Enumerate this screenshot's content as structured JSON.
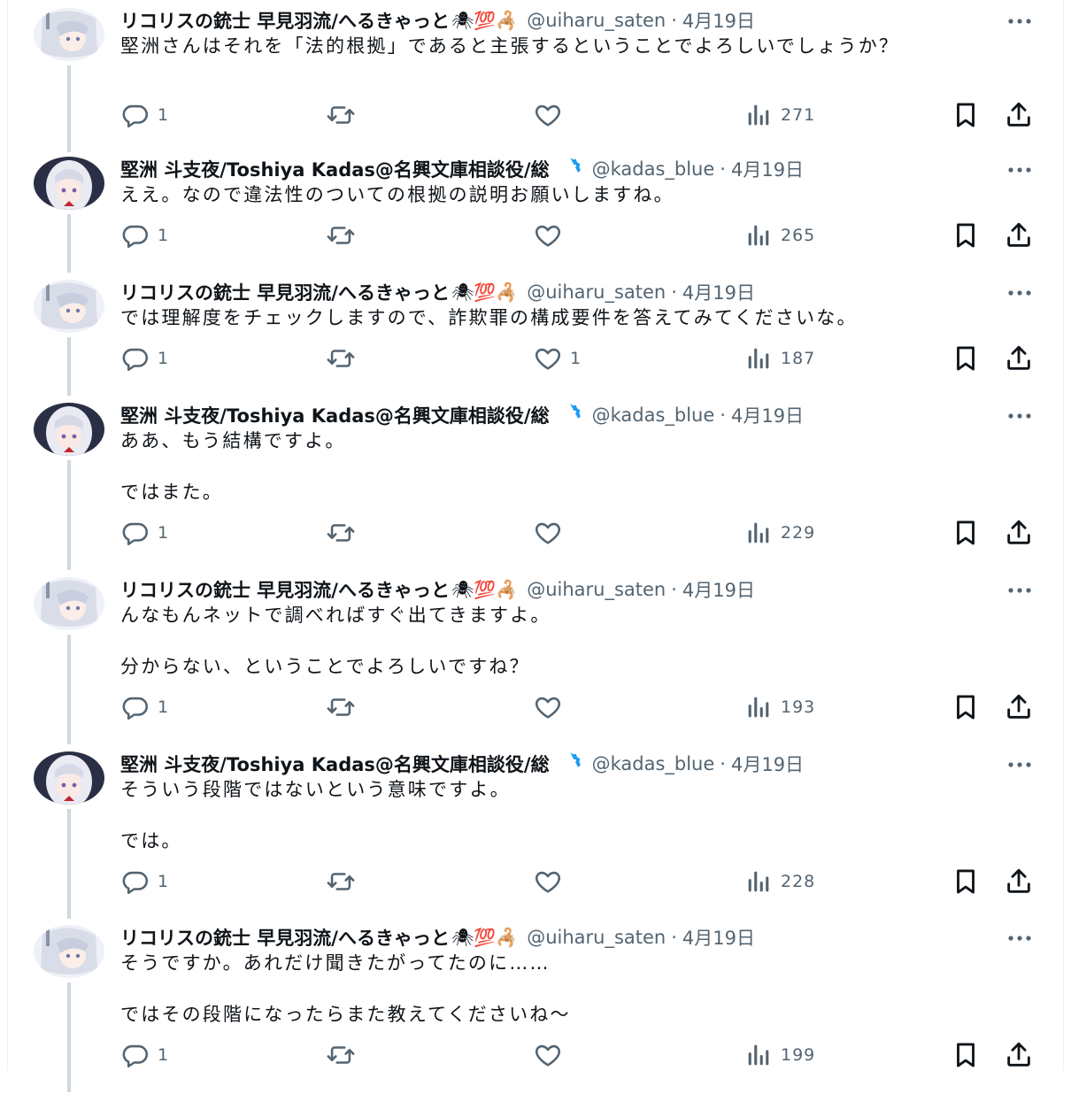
{
  "users": {
    "uiharu": {
      "name": "リコリスの銃士 早見羽流/へるきゃっと",
      "name_emoji": "🕷💯🦂",
      "handle": "@uiharu_saten",
      "verified": false
    },
    "kadas": {
      "name": "堅洲 斗支夜/Toshiya Kadas@名興文庫相談役/総",
      "name_emoji": "",
      "handle": "@kadas_blue",
      "verified": true
    }
  },
  "separator": "·",
  "tweets": [
    {
      "user": "uiharu",
      "name": "リコリスの銃士 早見羽流/へるきゃっと",
      "name_emoji": "🕷💯🦂",
      "handle": "@uiharu_saten",
      "date": "4月19日",
      "paragraphs": [
        "堅洲さんはそれを「法的根拠」であると主張するということでよろしいでしょうか？"
      ],
      "replies": "1",
      "retweets": "",
      "likes": "",
      "views": "271"
    },
    {
      "user": "kadas",
      "name": "堅洲 斗支夜/Toshiya Kadas@名興文庫相談役/総",
      "name_emoji": "",
      "handle": "@kadas_blue",
      "date": "4月19日",
      "paragraphs": [
        "ええ。なので違法性のついての根拠の説明お願いしますね。"
      ],
      "replies": "1",
      "retweets": "",
      "likes": "",
      "views": "265"
    },
    {
      "user": "uiharu",
      "name": "リコリスの銃士 早見羽流/へるきゃっと",
      "name_emoji": "🕷💯🦂",
      "handle": "@uiharu_saten",
      "date": "4月19日",
      "paragraphs": [
        "では理解度をチェックしますので、詐欺罪の構成要件を答えてみてくださいな。"
      ],
      "replies": "1",
      "retweets": "",
      "likes": "1",
      "views": "187"
    },
    {
      "user": "kadas",
      "name": "堅洲 斗支夜/Toshiya Kadas@名興文庫相談役/総",
      "name_emoji": "",
      "handle": "@kadas_blue",
      "date": "4月19日",
      "paragraphs": [
        "ああ、もう結構ですよ。",
        "ではまた。"
      ],
      "replies": "1",
      "retweets": "",
      "likes": "",
      "views": "229"
    },
    {
      "user": "uiharu",
      "name": "リコリスの銃士 早見羽流/へるきゃっと",
      "name_emoji": "🕷💯🦂",
      "handle": "@uiharu_saten",
      "date": "4月19日",
      "paragraphs": [
        "んなもんネットで調べればすぐ出てきますよ。",
        "分からない、ということでよろしいですね？"
      ],
      "replies": "1",
      "retweets": "",
      "likes": "",
      "views": "193"
    },
    {
      "user": "kadas",
      "name": "堅洲 斗支夜/Toshiya Kadas@名興文庫相談役/総",
      "name_emoji": "",
      "handle": "@kadas_blue",
      "date": "4月19日",
      "paragraphs": [
        "そういう段階ではないという意味ですよ。",
        "では。"
      ],
      "replies": "1",
      "retweets": "",
      "likes": "",
      "views": "228"
    },
    {
      "user": "uiharu",
      "name": "リコリスの銃士 早見羽流/へるきゃっと",
      "name_emoji": "🕷💯🦂",
      "handle": "@uiharu_saten",
      "date": "4月19日",
      "paragraphs": [
        "そうですか。あれだけ聞きたがってたのに……",
        "ではその段階になったらまた教えてくださいね〜"
      ],
      "replies": "1",
      "retweets": "",
      "likes": "",
      "views": "199"
    }
  ],
  "colors": {
    "text": "#0f1419",
    "secondary": "#536471",
    "thread_line": "#cfd9de",
    "verified": "#1d9bf0"
  },
  "icons": {
    "reply": "reply-icon",
    "retweet": "retweet-icon",
    "like": "heart-icon",
    "views": "views-icon",
    "bookmark": "bookmark-icon",
    "share": "share-icon",
    "more": "more-icon",
    "verified": "verified-badge-icon"
  }
}
